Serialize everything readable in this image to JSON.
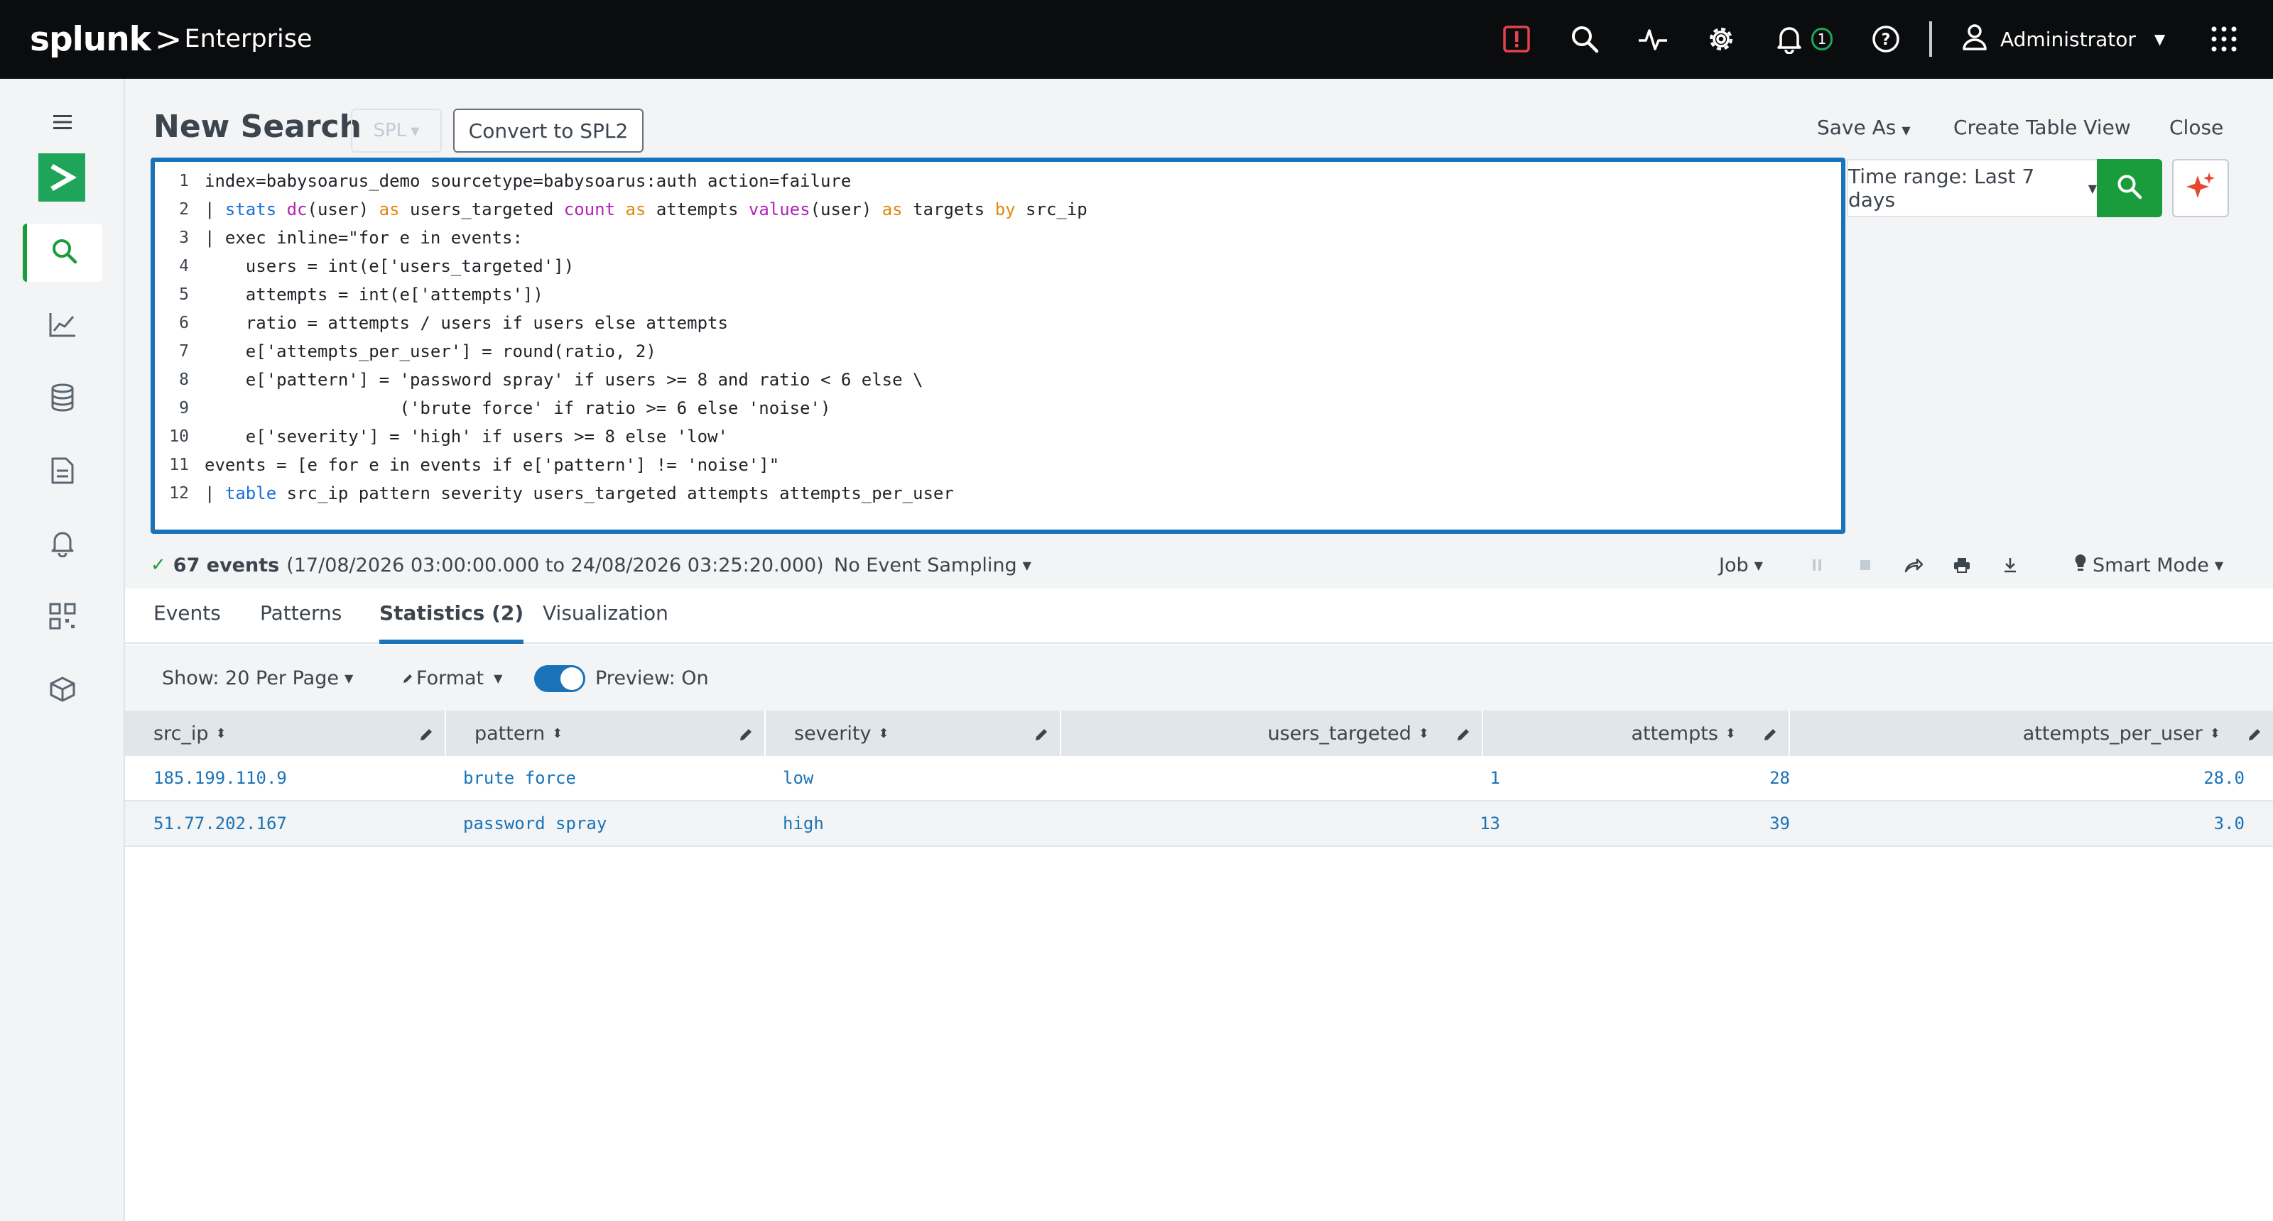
{
  "app": {
    "logo_brand": "splunk",
    "logo_caret": ">",
    "logo_product": "Enterprise"
  },
  "topbar": {
    "icons": [
      "alert-icon",
      "search-icon",
      "activity-icon",
      "settings-icon",
      "bell-icon",
      "help-icon",
      "user-icon",
      "apps-grid-icon"
    ],
    "notification_count": "1",
    "user_name": "Administrator",
    "colors": {
      "background": "#0b0c0e",
      "alert": "#e5424d",
      "badge": "#1fa55a"
    }
  },
  "sidebar": {
    "items": [
      "menu",
      "app-home",
      "search",
      "dashboards",
      "datasets",
      "reports",
      "alerts",
      "apps",
      "packages"
    ],
    "active": "search",
    "colors": {
      "active": "#1a9c3c"
    }
  },
  "header": {
    "title": "New Search",
    "spl_label": "SPL",
    "convert_label": "Convert to SPL2",
    "save_as_label": "Save As",
    "create_table_view_label": "Create Table View",
    "close_label": "Close"
  },
  "editor": {
    "lines": [
      {
        "n": "1",
        "tokens": [
          {
            "t": "index=babysoarus_demo sourcetype=babysoarus:auth action=failure"
          }
        ]
      },
      {
        "n": "2",
        "tokens": [
          {
            "t": "| "
          },
          {
            "t": "stats",
            "c": "kw"
          },
          {
            "t": " "
          },
          {
            "t": "dc",
            "c": "fn"
          },
          {
            "t": "(user) "
          },
          {
            "t": "as",
            "c": "op"
          },
          {
            "t": " users_targeted "
          },
          {
            "t": "count",
            "c": "fn"
          },
          {
            "t": " "
          },
          {
            "t": "as",
            "c": "op"
          },
          {
            "t": " attempts "
          },
          {
            "t": "values",
            "c": "fn"
          },
          {
            "t": "(user) "
          },
          {
            "t": "as",
            "c": "op"
          },
          {
            "t": " targets "
          },
          {
            "t": "by",
            "c": "op"
          },
          {
            "t": " src_ip"
          }
        ]
      },
      {
        "n": "3",
        "tokens": [
          {
            "t": "| exec inline=\"for e in events:"
          }
        ]
      },
      {
        "n": "4",
        "tokens": [
          {
            "t": "    users = int(e['users_targeted'])"
          }
        ]
      },
      {
        "n": "5",
        "tokens": [
          {
            "t": "    attempts = int(e['attempts'])"
          }
        ]
      },
      {
        "n": "6",
        "tokens": [
          {
            "t": "    ratio = attempts / users if users else attempts"
          }
        ]
      },
      {
        "n": "7",
        "tokens": [
          {
            "t": "    e['attempts_per_user'] = round(ratio, 2)"
          }
        ]
      },
      {
        "n": "8",
        "tokens": [
          {
            "t": "    e['pattern'] = 'password spray' if users >= 8 and ratio < 6 else \\"
          }
        ]
      },
      {
        "n": "9",
        "tokens": [
          {
            "t": "                   ('brute force' if ratio >= 6 else 'noise')"
          }
        ]
      },
      {
        "n": "10",
        "tokens": [
          {
            "t": "    e['severity'] = 'high' if users >= 8 else 'low'"
          }
        ]
      },
      {
        "n": "11",
        "tokens": [
          {
            "t": "events = [e for e in events if e['pattern'] != 'noise']\""
          }
        ]
      },
      {
        "n": "12",
        "tokens": [
          {
            "t": "| "
          },
          {
            "t": "table",
            "c": "kw"
          },
          {
            "t": " src_ip pattern severity users_targeted attempts attempts_per_user"
          }
        ]
      }
    ],
    "colors": {
      "border": "#1a73b8",
      "keyword": "#1a6fd4",
      "function": "#b023b6",
      "operator": "#e2870f"
    }
  },
  "search_controls": {
    "time_range_label": "Time range: Last 7 days",
    "colors": {
      "search_button": "#1a9c3c"
    }
  },
  "status": {
    "events_label": "67 events",
    "range_text": "(17/08/2026 03:00:00.000 to 24/08/2026 03:25:20.000)",
    "sampling_label": "No Event Sampling",
    "job_label": "Job",
    "mode_label": "Smart Mode"
  },
  "tabs": [
    {
      "label": "Events"
    },
    {
      "label": "Patterns"
    },
    {
      "label": "Statistics (2)",
      "active": true
    },
    {
      "label": "Visualization"
    }
  ],
  "toolbar": {
    "per_page_label": "Show: 20 Per Page",
    "format_label": "Format",
    "preview_label": "Preview: On",
    "preview_on": true
  },
  "table": {
    "columns": [
      "src_ip",
      "pattern",
      "severity",
      "users_targeted",
      "attempts",
      "attempts_per_user"
    ],
    "rows": [
      [
        "185.199.110.9",
        "brute force",
        "low",
        "1",
        "28",
        "28.0"
      ],
      [
        "51.77.202.167",
        "password spray",
        "high",
        "13",
        "39",
        "3.0"
      ]
    ]
  }
}
